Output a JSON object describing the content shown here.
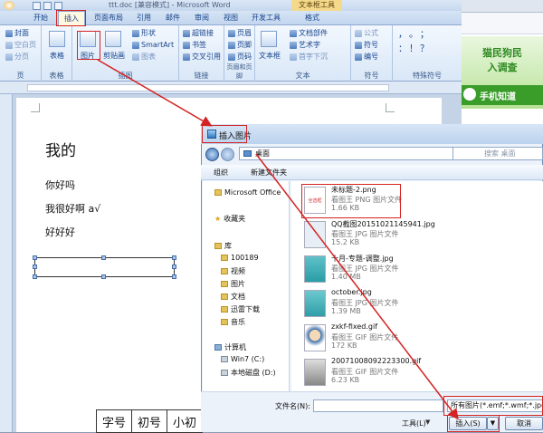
{
  "title_bar": {
    "doc_title": "ttt.doc [兼容模式] - Microsoft Word",
    "context_label": "文本框工具"
  },
  "tabs": [
    "开始",
    "插入",
    "页面布局",
    "引用",
    "邮件",
    "审阅",
    "视图",
    "开发工具",
    "格式"
  ],
  "ribbon": {
    "page_group": {
      "label": "页",
      "items": [
        "封面",
        "空白页",
        "分页"
      ]
    },
    "table_group": {
      "label": "表格",
      "button": "表格"
    },
    "illustrations_group": {
      "label": "插图",
      "picture": "图片",
      "clipart": "剪贴画",
      "items": [
        "形状",
        "SmartArt",
        "图表"
      ]
    },
    "links_group": {
      "label": "链接",
      "items": [
        "超链接",
        "书签",
        "交叉引用"
      ]
    },
    "header_group": {
      "label": "页眉和页脚",
      "items": [
        "页眉",
        "页脚",
        "页码"
      ]
    },
    "text_group": {
      "label": "文本",
      "textbox": "文本框",
      "items": [
        "文档部件",
        "艺术字",
        "首字下沉"
      ]
    },
    "symbols_group": {
      "label": "符号",
      "items": [
        "公式",
        "符号",
        "编号"
      ]
    },
    "special_group": {
      "label": "特殊符号"
    }
  },
  "document": {
    "heading": "我的",
    "lines": [
      "你好吗",
      "我很好啊 a√",
      "好好好"
    ],
    "table_cells": [
      "字号",
      "初号",
      "小初"
    ]
  },
  "side_ad": {
    "line1": "猫民狗民",
    "line2": "入调查",
    "bar": "手机知道"
  },
  "dialog": {
    "title": "插入图片",
    "breadcrumb": "桌面",
    "search_placeholder": "搜索 桌面",
    "toolbar": {
      "organize": "组织",
      "new_folder": "新建文件夹"
    },
    "nav": {
      "office": "Microsoft Office",
      "favorites": "收藏夹",
      "library": "库",
      "library_items": [
        "100189",
        "视频",
        "图片",
        "文档",
        "迅雷下载",
        "音乐"
      ],
      "computer": "计算机",
      "drives": [
        "Win7 (C:)",
        "本地磁盘 (D:)"
      ]
    },
    "files": [
      {
        "name": "未标题-2.png",
        "type": "看图王 PNG 图片文件",
        "size": "1.66 KB"
      },
      {
        "name": "QQ截图20151021145941.jpg",
        "type": "看图王 JPG 图片文件",
        "size": "15.2 KB"
      },
      {
        "name": "十月-专题-调整.jpg",
        "type": "看图王 JPG 图片文件",
        "size": "1.40 MB"
      },
      {
        "name": "october.jpg",
        "type": "看图王 JPG 图片文件",
        "size": "1.39 MB"
      },
      {
        "name": "zxkf-fixed.gif",
        "type": "看图王 GIF 图片文件",
        "size": "172 KB"
      },
      {
        "name": "20071008092223300.gif",
        "type": "看图王 GIF 图片文件",
        "size": "6.23 KB"
      }
    ],
    "thumb0_text": "全选框",
    "filename_label": "文件名(N):",
    "filetype_value": "所有图片(*.emf;*.wmf;*.jpg;*.jp",
    "tools_label": "工具(L)",
    "insert_label": "插入(S)",
    "cancel_label": "取消"
  },
  "colors": {
    "accent_red": "#d42323",
    "ribbon_blue": "#15428b",
    "ad_green": "#3a9d2a"
  }
}
